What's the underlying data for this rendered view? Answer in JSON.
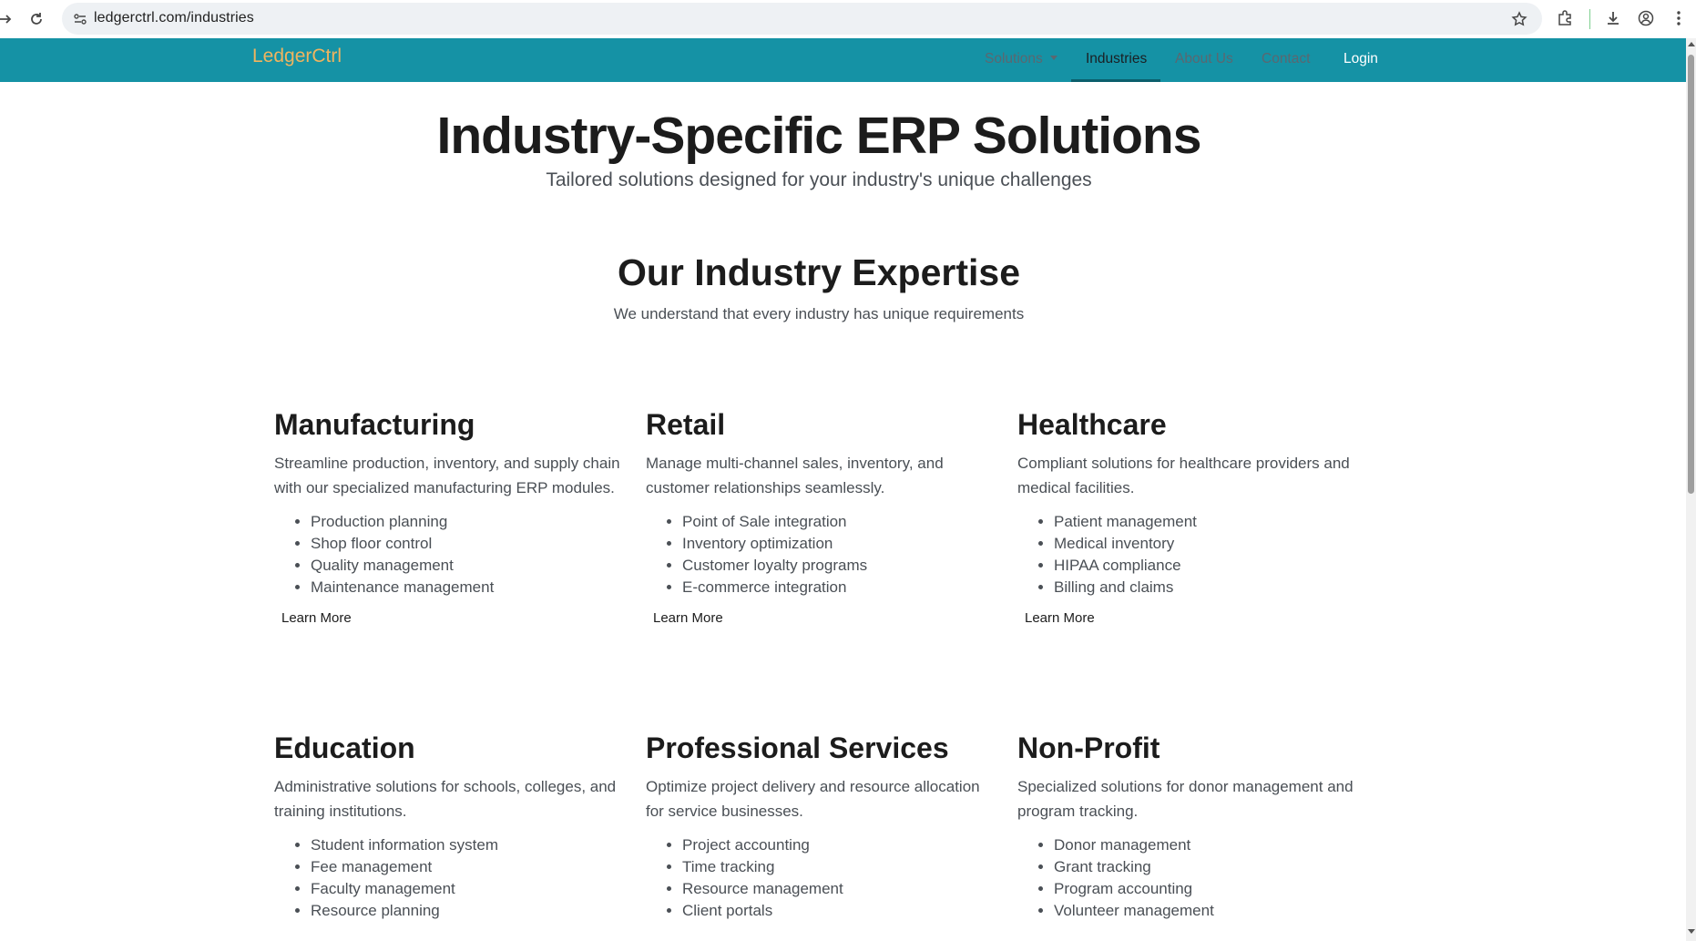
{
  "browser": {
    "url": "ledgerctrl.com/industries",
    "icons": [
      "back-arrow-icon",
      "reload-icon",
      "site-info-icon",
      "bookmark-star-icon",
      "extensions-icon",
      "download-icon",
      "profile-icon",
      "more-menu-icon"
    ]
  },
  "navbar": {
    "brand": "LedgerCtrl",
    "links": {
      "solutions": "Solutions",
      "industries": "Industries",
      "about": "About Us",
      "contact": "Contact",
      "login": "Login"
    },
    "colors": {
      "bar": "#1592a5",
      "brand": "#f0b45f"
    }
  },
  "hero": {
    "title": "Industry-Specific ERP Solutions",
    "subtitle": "Tailored solutions designed for your industry's unique challenges"
  },
  "expertise": {
    "title": "Our Industry Expertise",
    "subtitle": "We understand that every industry has unique requirements"
  },
  "industries": [
    {
      "name": "Manufacturing",
      "description": "Streamline production, inventory, and supply chain with our specialized manufacturing ERP modules.",
      "features": [
        "Production planning",
        "Shop floor control",
        "Quality management",
        "Maintenance management"
      ],
      "cta": "Learn More"
    },
    {
      "name": "Retail",
      "description": "Manage multi-channel sales, inventory, and customer relationships seamlessly.",
      "features": [
        "Point of Sale integration",
        "Inventory optimization",
        "Customer loyalty programs",
        "E-commerce integration"
      ],
      "cta": "Learn More"
    },
    {
      "name": "Healthcare",
      "description": "Compliant solutions for healthcare providers and medical facilities.",
      "features": [
        "Patient management",
        "Medical inventory",
        "HIPAA compliance",
        "Billing and claims"
      ],
      "cta": "Learn More"
    },
    {
      "name": "Education",
      "description": "Administrative solutions for schools, colleges, and training institutions.",
      "features": [
        "Student information system",
        "Fee management",
        "Faculty management",
        "Resource planning"
      ],
      "cta": ""
    },
    {
      "name": "Professional Services",
      "description": "Optimize project delivery and resource allocation for service businesses.",
      "features": [
        "Project accounting",
        "Time tracking",
        "Resource management",
        "Client portals"
      ],
      "cta": ""
    },
    {
      "name": "Non-Profit",
      "description": "Specialized solutions for donor management and program tracking.",
      "features": [
        "Donor management",
        "Grant tracking",
        "Program accounting",
        "Volunteer management"
      ],
      "cta": ""
    }
  ]
}
